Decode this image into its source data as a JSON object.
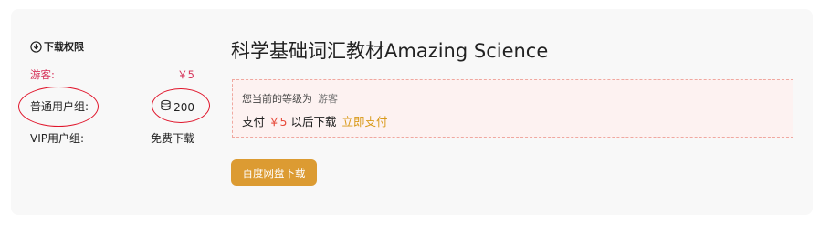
{
  "permissions": {
    "title": "下载权限",
    "rows": [
      {
        "label": "游客:",
        "value": "￥5"
      },
      {
        "label": "普通用户组:",
        "value": "200"
      },
      {
        "label": "VIP用户组:",
        "value": "免费下载"
      }
    ]
  },
  "post": {
    "title": "科学基础词汇教材Amazing Science"
  },
  "pay_box": {
    "level_prefix": "您当前的等级为",
    "level": "游客",
    "pay_prefix": "支付",
    "price": "￥5",
    "pay_suffix": "以后下载",
    "pay_link": "立即支付"
  },
  "download_button": {
    "label": "百度网盘下载"
  },
  "colors": {
    "guest_red": "#d6335a",
    "price_red": "#e74c3c",
    "accent_orange": "#dc9b32",
    "annotation_red": "#e0142a"
  },
  "icons": {
    "download": "download-circle-icon",
    "coin": "coin-stack-icon"
  }
}
